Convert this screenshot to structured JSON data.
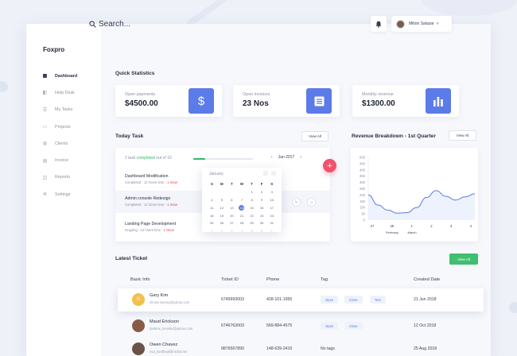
{
  "sidebar": {
    "brand": "Foxpro",
    "items": [
      {
        "label": "Dashboard",
        "icon": "grid-icon",
        "glyph": "▦"
      },
      {
        "label": "Help Desk",
        "icon": "headset-icon",
        "glyph": "◧"
      },
      {
        "label": "My Tasks",
        "icon": "tasks-icon",
        "glyph": "☰"
      },
      {
        "label": "Projects",
        "icon": "folder-icon",
        "glyph": "▭"
      },
      {
        "label": "Clients",
        "icon": "users-icon",
        "glyph": "◍"
      },
      {
        "label": "Invoice",
        "icon": "invoice-icon",
        "glyph": "▤"
      },
      {
        "label": "Reports",
        "icon": "chart-icon",
        "glyph": "◫"
      },
      {
        "label": "Settings",
        "icon": "gear-icon",
        "glyph": "✲"
      }
    ]
  },
  "header": {
    "search_placeholder": "Search...",
    "user_name": "Milton Salazar"
  },
  "quick_stats": {
    "title": "Quick Statistics",
    "cards": [
      {
        "label": "Open payments",
        "value": "$4500.00",
        "icon": "dollar-icon"
      },
      {
        "label": "Open invoices",
        "value": "23 Nos",
        "icon": "document-icon"
      },
      {
        "label": "Monthly revenue",
        "value": "$1300.00",
        "icon": "bar-chart-icon"
      }
    ]
  },
  "today_task": {
    "title": "Today Task",
    "view_all": "View All",
    "summary_prefix": "2 task ",
    "summary_highlight": "completed",
    "summary_suffix": " out of 10",
    "progress": 0.2,
    "month": "Jan 2017",
    "tasks": [
      {
        "name": "Dashboard Modification",
        "meta": "Completed - 12 hours time - ",
        "issue": "1 issue"
      },
      {
        "name": "Admin console Redesign",
        "meta": "Completed - 12 hours time - ",
        "issue": "1 issue"
      },
      {
        "name": "Landing Page Development",
        "meta": "Ongoing - 12 hours time - ",
        "issue": "1 issue"
      }
    ]
  },
  "calendar": {
    "month": "January",
    "weekdays": [
      "S",
      "M",
      "T",
      "W",
      "T",
      "F",
      "S"
    ],
    "days": [
      {
        "d": "",
        "dim": false
      },
      {
        "d": "",
        "dim": false
      },
      {
        "d": "",
        "dim": false
      },
      {
        "d": "",
        "dim": false
      },
      {
        "d": "1",
        "dim": false
      },
      {
        "d": "2",
        "dim": false
      },
      {
        "d": "3",
        "dim": false
      },
      {
        "d": "4",
        "dim": false
      },
      {
        "d": "5",
        "dim": false
      },
      {
        "d": "6",
        "dim": false
      },
      {
        "d": "7",
        "dim": false
      },
      {
        "d": "8",
        "dim": false
      },
      {
        "d": "9",
        "dim": false
      },
      {
        "d": "10",
        "dim": false
      },
      {
        "d": "11",
        "dim": false
      },
      {
        "d": "12",
        "dim": false
      },
      {
        "d": "13",
        "dim": false
      },
      {
        "d": "14",
        "dim": false,
        "sel": true
      },
      {
        "d": "15",
        "dim": false
      },
      {
        "d": "16",
        "dim": false
      },
      {
        "d": "17",
        "dim": false
      },
      {
        "d": "18",
        "dim": false
      },
      {
        "d": "19",
        "dim": false
      },
      {
        "d": "20",
        "dim": false
      },
      {
        "d": "21",
        "dim": false
      },
      {
        "d": "22",
        "dim": false
      },
      {
        "d": "23",
        "dim": false
      },
      {
        "d": "24",
        "dim": false
      },
      {
        "d": "25",
        "dim": false
      },
      {
        "d": "26",
        "dim": false
      },
      {
        "d": "27",
        "dim": false
      },
      {
        "d": "28",
        "dim": false
      },
      {
        "d": "29",
        "dim": false
      },
      {
        "d": "30",
        "dim": false
      },
      {
        "d": "31",
        "dim": false
      },
      {
        "d": "1",
        "dim": true
      },
      {
        "d": "2",
        "dim": true
      },
      {
        "d": "3",
        "dim": true
      },
      {
        "d": "4",
        "dim": true
      },
      {
        "d": "5",
        "dim": true
      },
      {
        "d": "6",
        "dim": true
      },
      {
        "d": "7",
        "dim": true
      }
    ]
  },
  "revenue": {
    "title": "Revenue Breakdown - 1st Quarter",
    "view_all": "View All"
  },
  "chart_data": {
    "type": "area",
    "x": [
      0,
      1,
      2,
      3,
      4,
      5,
      6,
      7,
      8,
      9,
      10,
      11
    ],
    "tick_labels": [
      "27",
      "28",
      "1",
      "2",
      "3",
      "4"
    ],
    "month_labels": [
      "February",
      "March"
    ],
    "values": [
      200,
      120,
      80,
      55,
      60,
      100,
      180,
      235,
      190,
      160,
      185,
      210
    ],
    "ylim": [
      0,
      500
    ],
    "yticks": [
      0,
      50,
      100,
      150,
      200,
      250,
      300,
      350,
      400,
      450,
      500
    ],
    "color": "#5b7be8"
  },
  "latest_ticket": {
    "title": "Latest Ticket",
    "view_all": "View All",
    "headers": [
      "Basic Info",
      "Ticket ID",
      "Phone",
      "Tag",
      "Created Date"
    ],
    "rows": [
      {
        "initial": "G",
        "name": "Gary Kim",
        "email": "elmira.murray@yahoo.com",
        "ticket": "6745993003",
        "phone": "428-101-1955",
        "tags": [
          "Open",
          "Close",
          "Test"
        ],
        "date": "21 Jun 2018"
      },
      {
        "initial": "",
        "name": "Maud Erickson",
        "email": "darlene_kessler@yahoo.com",
        "ticket": "6746763003",
        "phone": "569-884-4575",
        "tags": [
          "Open",
          "Close"
        ],
        "date": "12 Oct 2018"
      },
      {
        "initial": "",
        "name": "Owen Chavez",
        "email": "ova_lundhauf@nichol.me",
        "ticket": "9876567890",
        "phone": "148-639-2415",
        "tags": [],
        "no_tags": "No tags",
        "date": "25 Aug 2018"
      }
    ]
  }
}
